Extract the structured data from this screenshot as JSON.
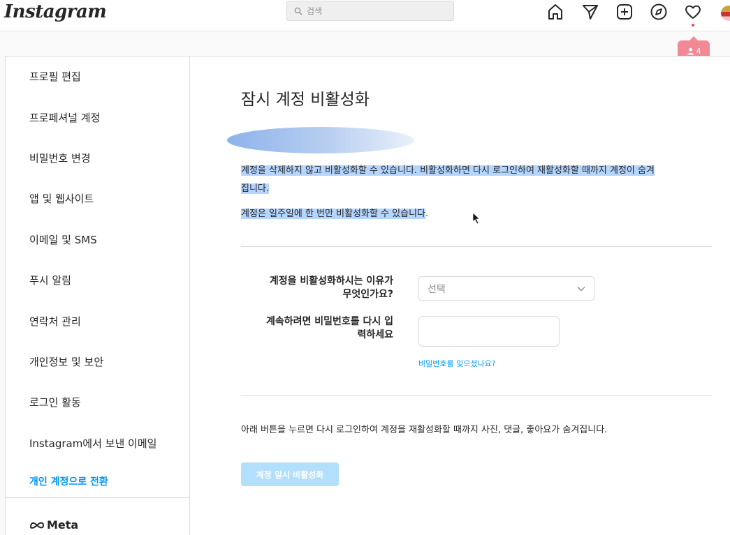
{
  "header": {
    "logo": "Instagram",
    "search_placeholder": "검색",
    "notification_count": "4"
  },
  "sidebar": {
    "items": [
      "프로필 편집",
      "프로페셔널 계정",
      "비밀번호 변경",
      "앱 및 웹사이트",
      "이메일 및 SMS",
      "푸시 알림",
      "연락처 관리",
      "개인정보 및 보안",
      "로그인 활동",
      "Instagram에서 보낸 이메일"
    ],
    "switch_account": "개인 계정으로 전환",
    "meta": "Meta"
  },
  "main": {
    "title": "잠시 계정 비활성화",
    "para1_line1": "계정을 삭제하지 않고 비활성화할 수 있습니다. 비활성화하면 다시 로그인하여 재활성화할 때까지 계정이 숨겨",
    "para1_line2": "집니다.",
    "para2": "계정은 일주일에 한 번만 비활성화할 수 있습니다",
    "para2_tail": ".",
    "reason_label_line1": "계정을 비활성화하시는 이유가",
    "reason_label_line2": "무엇인가요?",
    "reason_select": "선택",
    "password_label_line1": "계속하려면 비밀번호를 다시 입",
    "password_label_line2": "력하세요",
    "password_value": "",
    "forgot_password": "비밀번호를 잊으셨나요?",
    "note": "아래 버튼을 누르면 다시 로그인하여 계정을 재활성화할 때까지 사진, 댓글, 좋아요가 숨겨집니다.",
    "button": "계정 일시 비활성화"
  }
}
